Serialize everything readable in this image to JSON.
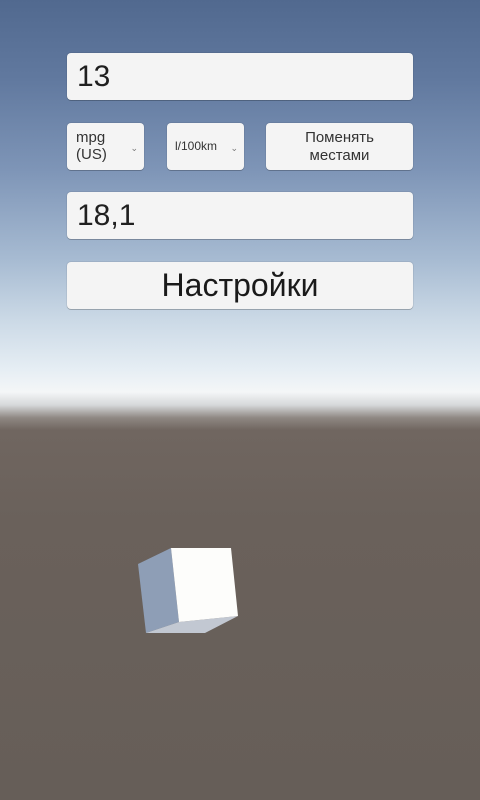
{
  "converter": {
    "input_value": "13",
    "from_unit": "mpg (US)",
    "to_unit": "l/100km",
    "swap_label": "Поменять местами",
    "result_value": "18,1",
    "settings_label": "Настройки",
    "dropdown_icon": "chevron-down-icon"
  },
  "scene": {
    "object": "cube",
    "colors": {
      "sky_top": "#51698f",
      "horizon": "#f4f6f7",
      "ground": "#665e58",
      "cube_front": "#fdfdfb",
      "cube_side": "#8e9eb6"
    }
  }
}
